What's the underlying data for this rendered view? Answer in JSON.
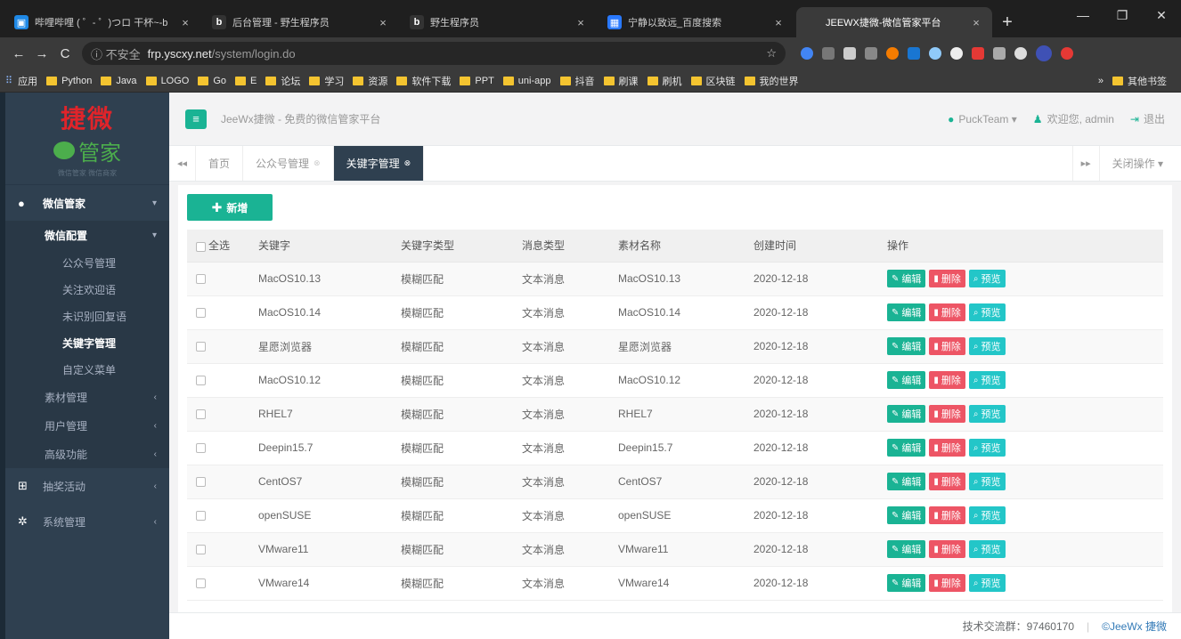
{
  "browser": {
    "tabs": [
      {
        "title": "哔哩哔哩 ( ゜- ゜)つロ 干杯~-b",
        "fav": "▣",
        "fav_color": "#1e88e5"
      },
      {
        "title": "后台管理 - 野生程序员",
        "fav": "b",
        "fav_color": "#333333"
      },
      {
        "title": "野生程序员",
        "fav": "b",
        "fav_color": "#333333"
      },
      {
        "title": "宁静以致远_百度搜索",
        "fav": "▦",
        "fav_color": "#2979ff"
      },
      {
        "title": "JEEWX捷微-微信管家平台",
        "fav": "",
        "fav_color": "#3a3a3a",
        "active": true
      }
    ],
    "new_tab": "+",
    "address": {
      "insecure": "ⓘ 不安全",
      "host": "frp.yscxy.net",
      "path": "/system/login.do"
    },
    "bookmarks": [
      "应用",
      "Python",
      "Java",
      "LOGO",
      "Go",
      "E",
      "论坛",
      "学习",
      "资源",
      "软件下载",
      "PPT",
      "uni-app",
      "抖音",
      "刷课",
      "刷机",
      "区块链",
      "我的世界"
    ],
    "bookmarks_more": "»",
    "bookmarks_other": "其他书签"
  },
  "sidebar": {
    "logo_brand": "捷微",
    "logo_sub": "管家",
    "logo_tiny": "微信管家 微信商家",
    "wechat_manager": "微信管家",
    "wechat_config": "微信配置",
    "config_items": [
      "公众号管理",
      "关注欢迎语",
      "未识别回复语",
      "关键字管理",
      "自定义菜单"
    ],
    "active_item": "关键字管理",
    "groups": [
      "素材管理",
      "用户管理",
      "高级功能"
    ],
    "lottery": "抽奖活动",
    "system": "系统管理"
  },
  "topnav": {
    "title": "JeeWx捷微 - 免费的微信管家平台",
    "team": "PuckTeam ▾",
    "welcome": "欢迎您, admin",
    "logout": "退出"
  },
  "content_tabs": {
    "home": "首页",
    "tab1": "公众号管理",
    "tab2": "关键字管理",
    "close_ops": "关闭操作 ▾"
  },
  "toolbar": {
    "add_label": "新增"
  },
  "table": {
    "headers": [
      "全选",
      "关键字",
      "关键字类型",
      "消息类型",
      "素材名称",
      "创建时间",
      "操作"
    ],
    "actions": {
      "edit": "编辑",
      "delete": "删除",
      "preview": "预览"
    },
    "rows": [
      {
        "keyword": "MacOS10.13",
        "ktype": "模糊匹配",
        "mtype": "文本消息",
        "material": "MacOS10.13",
        "date": "2020-12-18"
      },
      {
        "keyword": "MacOS10.14",
        "ktype": "模糊匹配",
        "mtype": "文本消息",
        "material": "MacOS10.14",
        "date": "2020-12-18"
      },
      {
        "keyword": "星愿浏览器",
        "ktype": "模糊匹配",
        "mtype": "文本消息",
        "material": "星愿浏览器",
        "date": "2020-12-18"
      },
      {
        "keyword": "MacOS10.12",
        "ktype": "模糊匹配",
        "mtype": "文本消息",
        "material": "MacOS10.12",
        "date": "2020-12-18"
      },
      {
        "keyword": "RHEL7",
        "ktype": "模糊匹配",
        "mtype": "文本消息",
        "material": "RHEL7",
        "date": "2020-12-18"
      },
      {
        "keyword": "Deepin15.7",
        "ktype": "模糊匹配",
        "mtype": "文本消息",
        "material": "Deepin15.7",
        "date": "2020-12-18"
      },
      {
        "keyword": "CentOS7",
        "ktype": "模糊匹配",
        "mtype": "文本消息",
        "material": "CentOS7",
        "date": "2020-12-18"
      },
      {
        "keyword": "openSUSE",
        "ktype": "模糊匹配",
        "mtype": "文本消息",
        "material": "openSUSE",
        "date": "2020-12-18"
      },
      {
        "keyword": "VMware11",
        "ktype": "模糊匹配",
        "mtype": "文本消息",
        "material": "VMware11",
        "date": "2020-12-18"
      },
      {
        "keyword": "VMware14",
        "ktype": "模糊匹配",
        "mtype": "文本消息",
        "material": "VMware14",
        "date": "2020-12-18"
      }
    ]
  },
  "footer": {
    "group_label": "技术交流群：97460170",
    "brand": "©JeeWx 捷微"
  },
  "colors": {
    "primary": "#1ab394",
    "danger": "#ed5565",
    "info": "#23c6c8",
    "sidebar": "#2f4050"
  }
}
